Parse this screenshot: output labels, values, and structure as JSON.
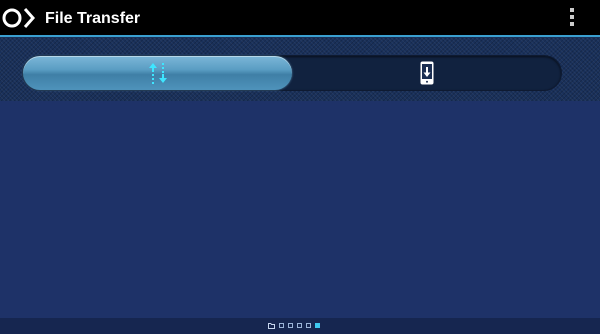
{
  "action_bar": {
    "title": "File Transfer",
    "app_icon": "circle-chevron-icon",
    "menu_icon": "overflow-menu-icon"
  },
  "tabs": [
    {
      "icon": "transfer-arrows-icon",
      "selected": true
    },
    {
      "icon": "phone-download-icon",
      "selected": false
    }
  ],
  "pager": {
    "count": 6,
    "active_index": 5,
    "first_icon": "folder-icon"
  },
  "colors": {
    "accent": "#3ec8f0",
    "background": "#1e3268",
    "action_bar": "#000000",
    "tab_selected": "#5a9dc3"
  }
}
